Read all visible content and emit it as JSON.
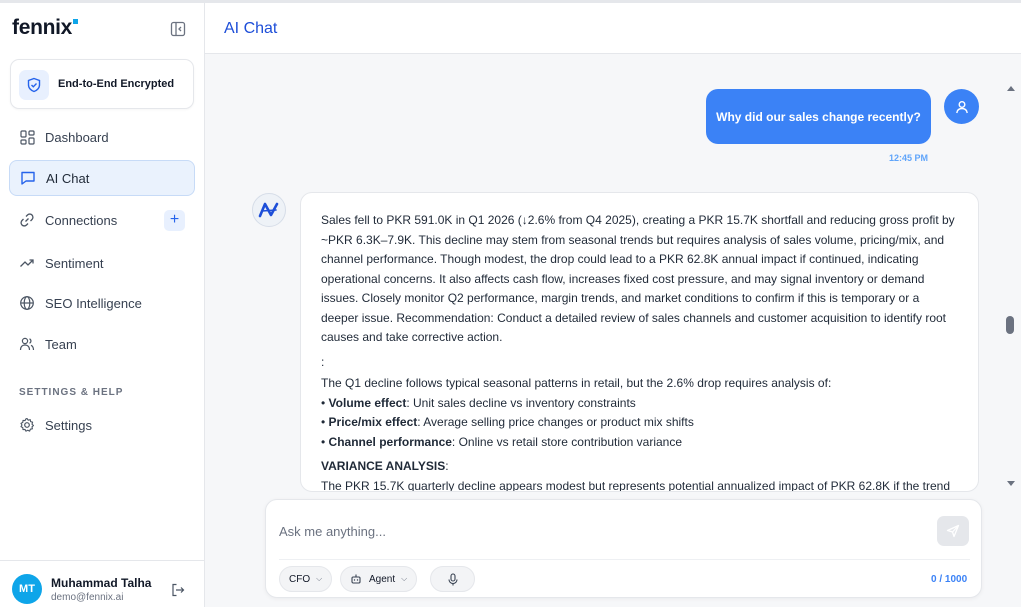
{
  "app": {
    "brand": "fennix"
  },
  "sidebar": {
    "encryption_label": "End-to-End Encrypted",
    "items": [
      {
        "label": "Dashboard",
        "icon": "grid-icon"
      },
      {
        "label": "AI Chat",
        "icon": "chat-icon",
        "active": true
      },
      {
        "label": "Connections",
        "icon": "link-icon"
      },
      {
        "label": "Sentiment",
        "icon": "trend-icon"
      },
      {
        "label": "SEO Intelligence",
        "icon": "globe-icon"
      },
      {
        "label": "Team",
        "icon": "users-icon"
      }
    ],
    "section_label": "SETTINGS & HELP",
    "settings_label": "Settings",
    "add_connection_symbol": "+",
    "user": {
      "initials": "MT",
      "name": "Muhammad Talha",
      "email": "demo@fennix.ai"
    }
  },
  "header": {
    "title": "AI Chat"
  },
  "chat": {
    "user_message": "Why did our sales change recently?",
    "user_message_time": "12:45 PM",
    "assistant_paragraph": "Sales fell to PKR 591.0K in Q1 2026 (↓2.6% from Q4 2025), creating a PKR 15.7K shortfall and reducing gross profit by ~PKR 6.3K–7.9K. This decline may stem from seasonal trends but requires analysis of sales volume, pricing/mix, and channel performance. Though modest, the drop could lead to a PKR 62.8K annual impact if continued, indicating operational concerns. It also affects cash flow, increases fixed cost pressure, and may signal inventory or demand issues. Closely monitor Q2 performance, margin trends, and market conditions to confirm if this is temporary or a deeper issue. Recommendation: Conduct a detailed review of sales channels and customer acquisition to identify root causes and take corrective action.",
    "colon_line": ":",
    "decline_intro": "The Q1 decline follows typical seasonal patterns in retail, but the 2.6% drop requires analysis of:",
    "bullets": [
      {
        "title": "Volume effect",
        "text": ": Unit sales decline vs inventory constraints"
      },
      {
        "title": "Price/mix effect",
        "text": ": Average selling price changes or product mix shifts"
      },
      {
        "title": "Channel performance",
        "text": ": Online vs retail store contribution variance"
      }
    ],
    "bullet_symbol": "•",
    "variance_heading": "VARIANCE ANALYSIS",
    "variance_heading_suffix": ":",
    "variance_text": "The PKR 15.7K quarterly decline appears modest but represents potential annualized impact of PKR 62.8K if the trend"
  },
  "composer": {
    "placeholder": "Ask me anything...",
    "role_label": "CFO",
    "mode_label": "Agent",
    "counter": "0 / 1000"
  },
  "colors": {
    "accent": "#3b82f6",
    "active_bg": "#eaf2fd",
    "avatar": "#0ea5e9"
  }
}
